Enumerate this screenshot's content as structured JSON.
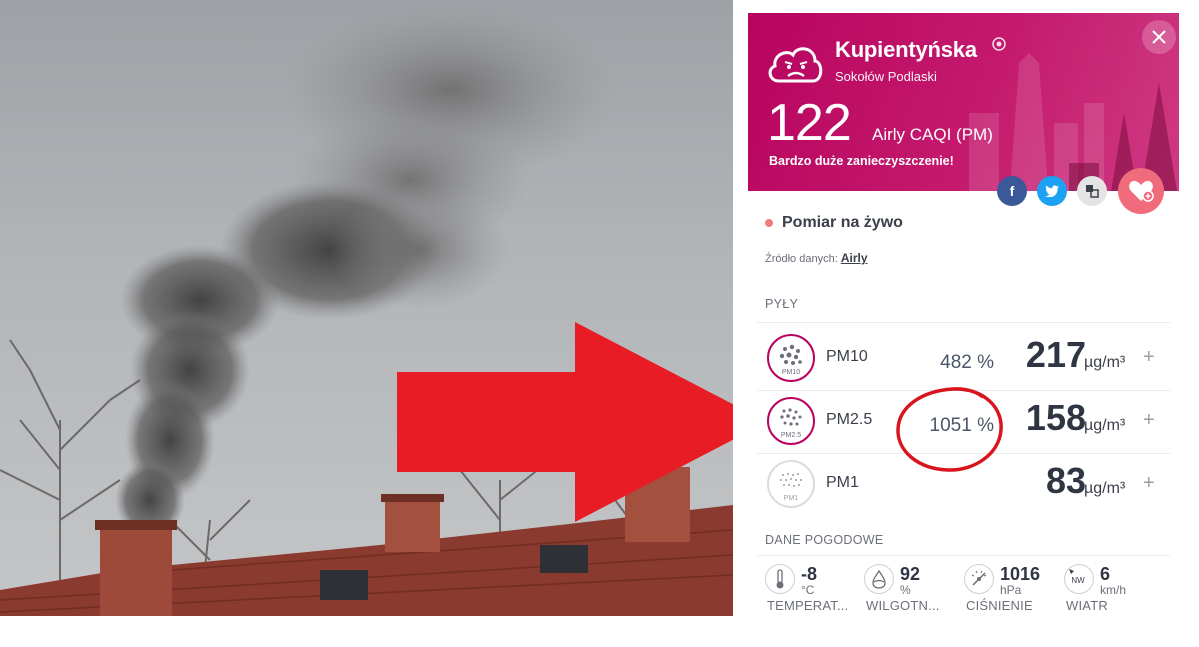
{
  "station": {
    "name": "Kupientyńska",
    "city": "Sokołów Podlaski",
    "caqi_value": "122",
    "caqi_label": "Airly CAQI (PM)",
    "caqi_description": "Bardzo duże zanieczyszczenie!",
    "brand_color": "#b8045f"
  },
  "social": {
    "facebook": "f",
    "twitter": "t"
  },
  "live": {
    "label": "Pomiar na żywo",
    "source_prefix": "Źródło danych:",
    "source_link": "Airly"
  },
  "particles": {
    "section_title": "PYŁY",
    "items": [
      {
        "name": "PM10",
        "icon_label": "PM10",
        "percent": "482 %",
        "value": "217",
        "unit": "µg/m³",
        "plus": "+"
      },
      {
        "name": "PM2.5",
        "icon_label": "PM2.5",
        "percent": "1051 %",
        "value": "158",
        "unit": "µg/m³",
        "plus": "+"
      },
      {
        "name": "PM1",
        "icon_label": "PM1",
        "percent": "",
        "value": "83",
        "unit": "µg/m³",
        "plus": "+"
      }
    ]
  },
  "weather": {
    "section_title": "DANE POGODOWE",
    "items": [
      {
        "value": "-8",
        "unit": "°C",
        "label": "TEMPERAT...",
        "icon": "thermometer-icon"
      },
      {
        "value": "92",
        "unit": "%",
        "label": "WILGOTN...",
        "icon": "humidity-icon"
      },
      {
        "value": "1016",
        "unit": "hPa",
        "label": "CIŚNIENIE",
        "icon": "pressure-gauge-icon"
      },
      {
        "value": "6",
        "unit": "km/h",
        "label": "WIATR",
        "icon": "wind-direction-icon",
        "direction": "NW"
      }
    ]
  },
  "colors": {
    "arrow": "#e81c24",
    "highlight_circle": "#d8141c",
    "favorite": "#f06b7b"
  }
}
